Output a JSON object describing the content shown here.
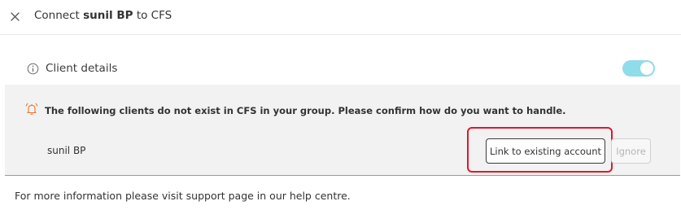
{
  "header": {
    "title_prefix": "Connect",
    "client_name": "sunil BP",
    "title_suffix": "to CFS",
    "close_icon": "close-icon"
  },
  "client_details": {
    "label": "Client details",
    "info_icon": "info-icon",
    "toggle_on": true,
    "toggle_color": "#8fdcea"
  },
  "notice": {
    "icon": "bell-icon",
    "icon_color": "#e8762c",
    "message": "The following clients do not exist in CFS in your group. Please confirm how do you want to handle."
  },
  "clients": [
    {
      "name": "sunil BP",
      "link_label": "Link to existing account",
      "ignore_label": "Ignore"
    }
  ],
  "highlight_color": "#e0182a",
  "footer": {
    "text": "For more information please visit support page in our help centre."
  }
}
